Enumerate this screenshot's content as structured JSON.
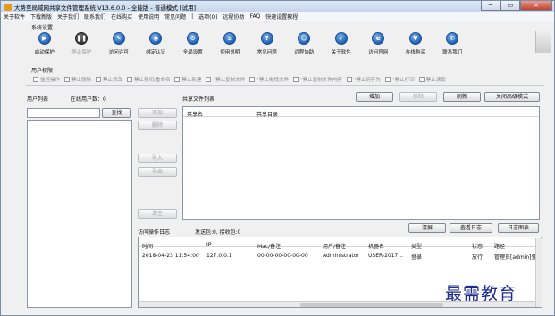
{
  "window": {
    "title": "大势至局域网共享文件管理系统 V13.6.0.0 - 全能版 - 普通模式 [试用]",
    "controls": [
      "─",
      "▭",
      "✕"
    ]
  },
  "menu": [
    "关于软件",
    "下载新版",
    "关于我们",
    "联系我们",
    "在线购买",
    "使用说明",
    "常见问题",
    "|",
    "选项(O)",
    "远程协助",
    "FAQ",
    "快速设置教程"
  ],
  "system_settings": {
    "label": "系统设置",
    "buttons": [
      {
        "label": "启动保护",
        "icon": "▶",
        "icon_name": "play-icon",
        "enabled": true
      },
      {
        "label": "停止保护",
        "icon": "❚❚",
        "icon_name": "pause-icon",
        "enabled": false
      },
      {
        "label": "访问许可",
        "icon": "✎",
        "icon_name": "edit-icon",
        "enabled": true
      },
      {
        "label": "绑定认证",
        "icon": "◉",
        "icon_name": "bind-icon",
        "enabled": true
      },
      {
        "label": "全局设置",
        "icon": "⚙",
        "icon_name": "gear-icon",
        "enabled": true
      },
      {
        "label": "使用说明",
        "icon": "≡",
        "icon_name": "manual-icon",
        "enabled": true
      },
      {
        "label": "常见问题",
        "icon": "?",
        "icon_name": "question-icon",
        "enabled": true
      },
      {
        "label": "远程协助",
        "icon": "☺",
        "icon_name": "remote-assist-icon",
        "enabled": true
      },
      {
        "label": "关于软件",
        "icon": "✓",
        "icon_name": "about-icon",
        "enabled": true
      },
      {
        "label": "访问官网",
        "icon": "e",
        "icon_name": "browser-icon",
        "enabled": true
      },
      {
        "label": "在线购买",
        "icon": "♥",
        "icon_name": "buy-icon",
        "enabled": true
      },
      {
        "label": "联系我们",
        "icon": "✆",
        "icon_name": "contact-icon",
        "enabled": true
      }
    ]
  },
  "user_permissions": {
    "label": "用户权限",
    "items": [
      "监控操作",
      "禁止删除",
      "禁止修改",
      "禁止剪切/重命名",
      "禁止新建",
      "*禁止复制文件",
      "*禁止拖拽文件",
      "*禁止复制文件内容",
      "*禁止另存为",
      "*禁止打印",
      "禁止读取"
    ]
  },
  "user_list": {
    "label": "用户列表",
    "online_label": "在线用户数：0",
    "search_button": "查找"
  },
  "side_buttons": [
    "添加",
    "删除",
    "导入",
    "导出",
    "清空"
  ],
  "share_list": {
    "label": "共享文件列表",
    "buttons": [
      "增加",
      "移除",
      "刷新",
      "关闭高级模式"
    ],
    "columns": [
      "共享名",
      "共享目录"
    ]
  },
  "log": {
    "label": "访问操作日志",
    "packets": "发送包:0, 接收包:0",
    "buttons": [
      "清屏",
      "查看日志",
      "日志图表"
    ],
    "columns": [
      "时间",
      "IP",
      "Mac/备注",
      "用户/备注",
      "机器名",
      "类型",
      "状态",
      "路径"
    ],
    "rows": [
      {
        "time": "2018-04-23 11:54:00",
        "ip": "127.0.0.1",
        "mac": "00-00-00-00-00-00",
        "user": "Administrator",
        "machine": "USER-2017...",
        "type": "登录",
        "status": "放行",
        "path": "管理员[admin]登"
      }
    ]
  },
  "watermark": "最需教育"
}
